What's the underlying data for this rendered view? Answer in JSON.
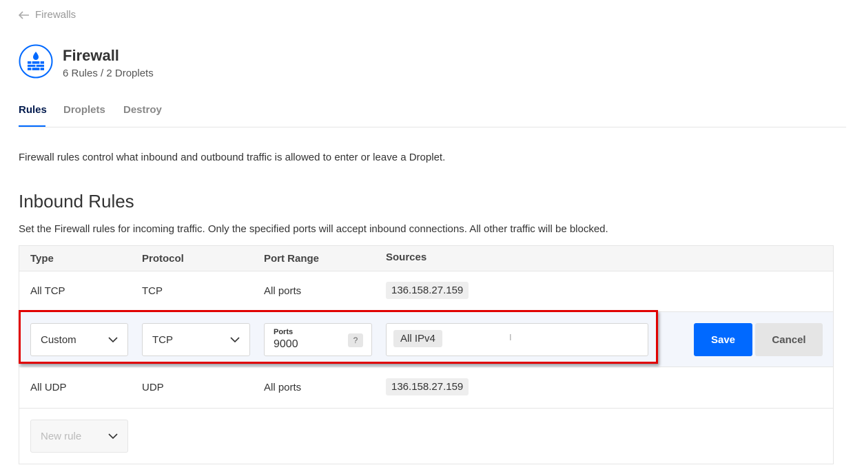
{
  "breadcrumb": {
    "back_label": "Firewalls"
  },
  "header": {
    "title": "Firewall",
    "subtitle": "6 Rules / 2 Droplets"
  },
  "tabs": [
    {
      "label": "Rules",
      "active": true
    },
    {
      "label": "Droplets",
      "active": false
    },
    {
      "label": "Destroy",
      "active": false
    }
  ],
  "description": "Firewall rules control what inbound and outbound traffic is allowed to enter or leave a Droplet.",
  "inbound": {
    "heading": "Inbound Rules",
    "description": "Set the Firewall rules for incoming traffic. Only the specified ports will accept inbound connections. All other traffic will be blocked.",
    "columns": [
      "Type",
      "Protocol",
      "Port Range",
      "Sources"
    ],
    "rows": [
      {
        "type": "All TCP",
        "protocol": "TCP",
        "port_range": "All ports",
        "source": "136.158.27.159"
      },
      {
        "type": "All UDP",
        "protocol": "UDP",
        "port_range": "All ports",
        "source": "136.158.27.159"
      }
    ],
    "edit_row": {
      "type_value": "Custom",
      "protocol_value": "TCP",
      "ports_label": "Ports",
      "ports_value": "9000",
      "ports_help": "?",
      "source_tag": "All IPv4",
      "save_label": "Save",
      "cancel_label": "Cancel"
    },
    "new_rule_placeholder": "New rule"
  },
  "colors": {
    "accent": "#0069ff",
    "highlight": "#e00000",
    "active_tab": "#031b4e"
  },
  "icons": {
    "back": "arrow-left-icon",
    "firewall": "firewall-icon",
    "dropdown": "chevron-down-icon"
  }
}
